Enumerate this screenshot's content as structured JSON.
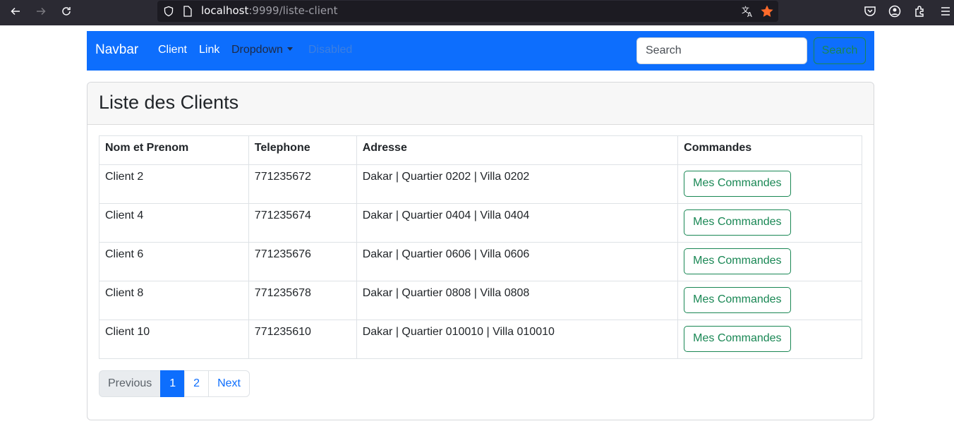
{
  "browser": {
    "url_host": "localhost",
    "url_rest": ":9999/liste-client"
  },
  "navbar": {
    "brand": "Navbar",
    "links": [
      "Client",
      "Link",
      "Dropdown",
      "Disabled"
    ],
    "search_placeholder": "Search",
    "search_button": "Search",
    "colors": {
      "navbar_bg": "#0d6efd",
      "success": "#198754"
    }
  },
  "page": {
    "title": "Liste des Clients"
  },
  "table": {
    "headers": [
      "Nom et Prenom",
      "Telephone",
      "Adresse",
      "Commandes"
    ],
    "rows": [
      {
        "name": "Client 2",
        "phone": "771235672",
        "address": "Dakar | Quartier 0202 | Villa 0202",
        "action": "Mes Commandes"
      },
      {
        "name": "Client 4",
        "phone": "771235674",
        "address": "Dakar | Quartier 0404 | Villa 0404",
        "action": "Mes Commandes"
      },
      {
        "name": "Client 6",
        "phone": "771235676",
        "address": "Dakar | Quartier 0606 | Villa 0606",
        "action": "Mes Commandes"
      },
      {
        "name": "Client 8",
        "phone": "771235678",
        "address": "Dakar | Quartier 0808 | Villa 0808",
        "action": "Mes Commandes"
      },
      {
        "name": "Client 10",
        "phone": "771235610",
        "address": "Dakar | Quartier 010010 | Villa 010010",
        "action": "Mes Commandes"
      }
    ]
  },
  "pagination": {
    "previous": "Previous",
    "pages": [
      "1",
      "2"
    ],
    "active_page": "1",
    "next": "Next"
  }
}
